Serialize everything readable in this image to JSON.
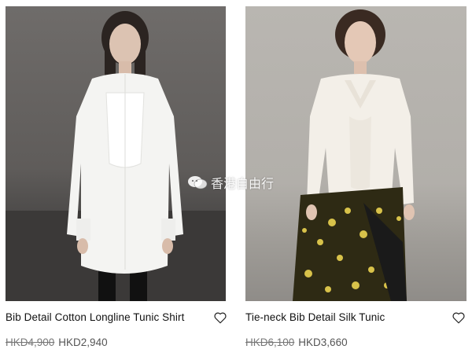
{
  "products": [
    {
      "name": "Bib Detail Cotton Longline Tunic Shirt",
      "old_price": "HKD4,900",
      "new_price": "HKD2,940",
      "image_alt": "",
      "wishlist_icon": "heart-outline-icon"
    },
    {
      "name": "Tie-neck Bib Detail Silk Tunic",
      "old_price": "HKD6,100",
      "new_price": "HKD3,660",
      "image_alt": "",
      "wishlist_icon": "heart-outline-icon"
    }
  ],
  "watermark": {
    "text": "香港自由行",
    "icon": "wechat-icon"
  },
  "colors": {
    "text": "#111111",
    "price": "#555555",
    "left_backdrop": "#625f5d",
    "right_backdrop": "#b4b1ac"
  }
}
